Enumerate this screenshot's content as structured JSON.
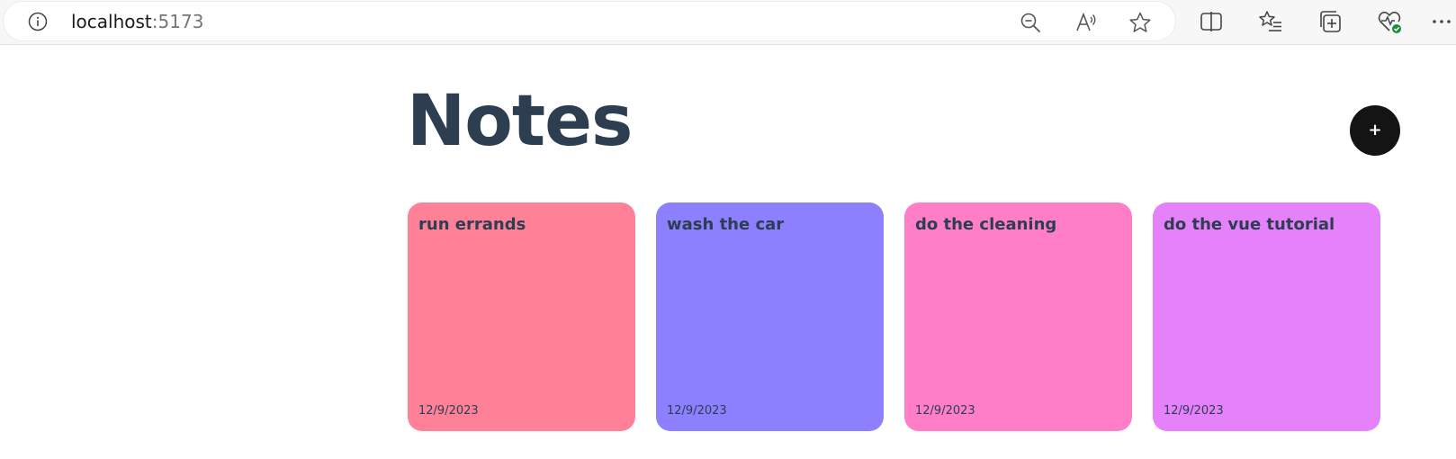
{
  "browser": {
    "url_host": "localhost",
    "url_port": ":5173",
    "icons": {
      "site_info": "info-icon",
      "zoom": "zoom-out-icon",
      "read_aloud": "read-aloud-icon",
      "favorite": "star-icon",
      "split_screen": "split-screen-icon",
      "favorites": "favorites-list-icon",
      "collections": "collections-icon",
      "health": "browser-essentials-icon",
      "more": "more-icon"
    }
  },
  "page": {
    "title": "Notes",
    "add_button_label": "+"
  },
  "notes": [
    {
      "title": "run errands",
      "date": "12/9/2023",
      "color": "#ff8198"
    },
    {
      "title": "wash the car",
      "date": "12/9/2023",
      "color": "#8c80ff"
    },
    {
      "title": "do the cleaning",
      "date": "12/9/2023",
      "color": "#ff7ec7"
    },
    {
      "title": "do the vue tutorial",
      "date": "12/9/2023",
      "color": "#e681fc"
    }
  ],
  "colors": {
    "title_text": "#2c3e50",
    "add_button_bg": "#141414"
  }
}
